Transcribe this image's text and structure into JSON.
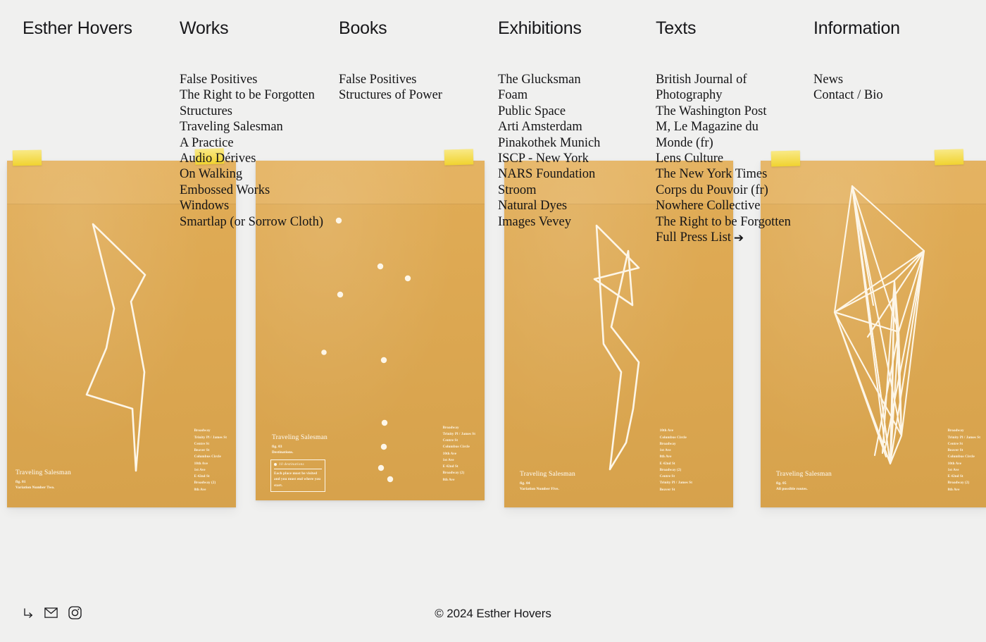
{
  "site": {
    "title": "Esther Hovers",
    "background_color": "#f0f0ef",
    "paper_color": "#e0a94f",
    "tape_color": "#f5dc3c",
    "ink_color": "#17171a"
  },
  "nav": {
    "brand": "Esther Hovers",
    "columns": [
      {
        "heading": "Works",
        "items": [
          "False Positives",
          "The Right to be Forgotten",
          "Structures",
          "Traveling Salesman",
          "A Practice",
          "Audio Dérives",
          "On Walking",
          "Embossed Works",
          "Windows",
          "Smartlap (or Sorrow Cloth)"
        ]
      },
      {
        "heading": "Books",
        "items": [
          "False Positives",
          "Structures of Power"
        ]
      },
      {
        "heading": "Exhibitions",
        "items": [
          "The Glucksman",
          "Foam",
          "Public Space",
          "Arti Amsterdam",
          "Pinakothek Munich",
          "ISCP - New York",
          "NARS Foundation",
          "Stroom",
          "Natural Dyes",
          "Images Vevey"
        ]
      },
      {
        "heading": "Texts",
        "items": [
          "British Journal of Photography",
          "The Washington Post",
          "M, Le Magazine du Monde (fr)",
          "Lens Culture",
          "The New York Times",
          "Corps du Pouvoir (fr)",
          "Nowhere Collective",
          "The Right to be Forgotten",
          "Full Press List"
        ],
        "last_item_arrow": "➔"
      },
      {
        "heading": "Information",
        "items": [
          "News",
          "Contact / Bio"
        ]
      }
    ]
  },
  "envelopes": [
    {
      "caption_title": "Traveling Salesman",
      "caption_fig": "fig. 01",
      "caption_sub": "Variation Number Two.",
      "addresses": [
        "Broadway",
        "Trinity Pl / James St",
        "Centre St",
        "Beaver St",
        "Columbus Circle",
        "10th Ave",
        "1st Ave",
        "E 42nd St",
        "Broadway (2)",
        "8th Ave"
      ]
    },
    {
      "caption_title": "Traveling Salesman",
      "caption_fig": "fig. 03",
      "caption_sub": "Destinations.",
      "note_head": "10 destinations",
      "note_body": "Each place must be visited and you must end where you start.",
      "addresses": [
        "Broadway",
        "Trinity Pl / James St",
        "Centre St",
        "Columbus Circle",
        "10th Ave",
        "1st Ave",
        "E 42nd St",
        "Broadway (2)",
        "8th Ave"
      ]
    },
    {
      "caption_title": "Traveling Salesman",
      "caption_fig": "fig. 04",
      "caption_sub": "Variation Number Five.",
      "addresses": [
        "10th Ave",
        "Columbus Circle",
        "Broadway",
        "1st Ave",
        "8th Ave",
        "E 42nd St",
        "Broadway (2)",
        "Centre St",
        "Trinity Pl / James St",
        "Beaver St"
      ]
    },
    {
      "caption_title": "Traveling Salesman",
      "caption_fig": "fig. 05",
      "caption_sub": "All possible routes.",
      "addresses": [
        "Broadway",
        "Trinity Pl / James St",
        "Centre St",
        "Beaver St",
        "Columbus Circle",
        "10th Ave",
        "1st Ave",
        "E 42nd St",
        "Broadway (2)",
        "8th Ave"
      ]
    }
  ],
  "footer": {
    "copyright": "© 2024 Esther Hovers",
    "social": [
      {
        "icon": "arrow-corner-icon",
        "label": "go"
      },
      {
        "icon": "mail-icon",
        "label": "Email"
      },
      {
        "icon": "instagram-icon",
        "label": "Instagram"
      }
    ]
  }
}
